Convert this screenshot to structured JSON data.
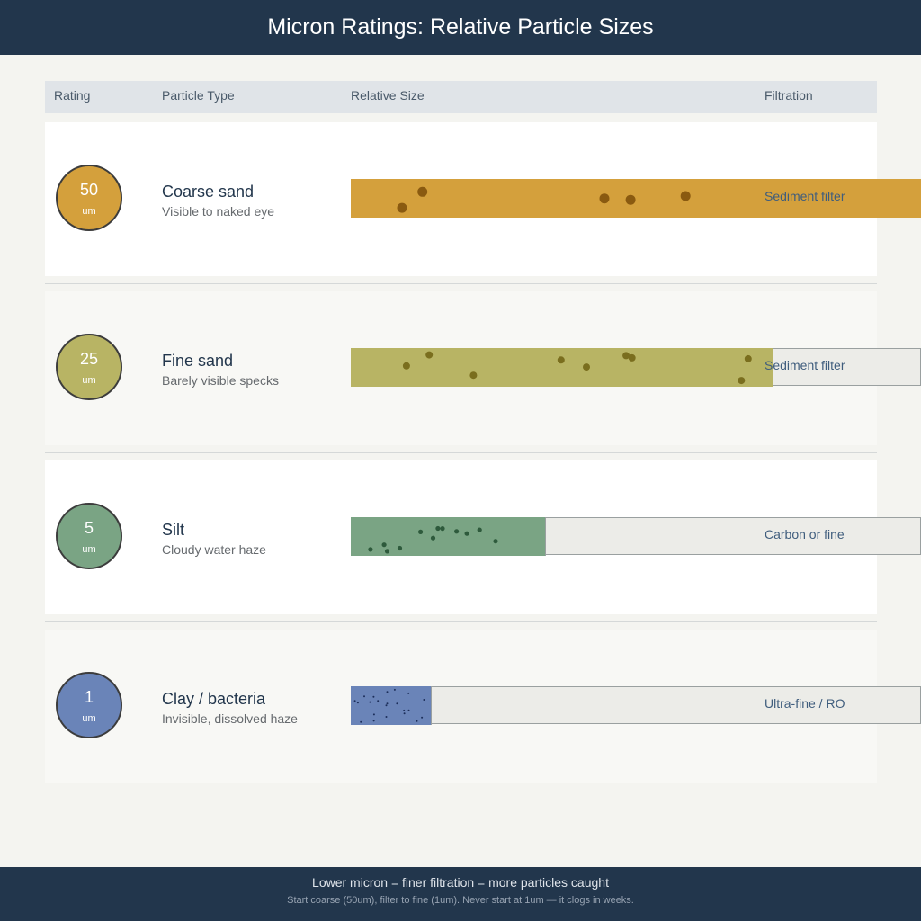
{
  "header": {
    "title": "Micron Ratings: Relative Particle Sizes"
  },
  "columns": {
    "rating": "Rating",
    "particle_type": "Particle Type",
    "relative_size": "Relative Size",
    "filtration": "Filtration"
  },
  "rows": [
    {
      "rating": "50",
      "unit": "um",
      "particle_type": "Coarse sand",
      "description": "Visible to naked eye",
      "filtration": "Sediment filter",
      "relative_size": 1.0,
      "color": "#d4a03c",
      "particle_color": "#8a5a10"
    },
    {
      "rating": "25",
      "unit": "um",
      "particle_type": "Fine sand",
      "description": "Barely visible specks",
      "filtration": "Sediment filter",
      "relative_size": 0.74,
      "color": "#b8b464",
      "particle_color": "#7a6e1e"
    },
    {
      "rating": "5",
      "unit": "um",
      "particle_type": "Silt",
      "description": "Cloudy water haze",
      "filtration": "Carbon or fine",
      "relative_size": 0.34,
      "color": "#7aa484",
      "particle_color": "#2e5a3c"
    },
    {
      "rating": "1",
      "unit": "um",
      "particle_type": "Clay / bacteria",
      "description": "Invisible, dissolved haze",
      "filtration": "Ultra-fine / RO",
      "relative_size": 0.14,
      "color": "#6a84b8",
      "particle_color": "#1c2e5a"
    }
  ],
  "footer": {
    "main": "Lower micron = finer filtration = more particles caught",
    "sub": "Start coarse (50um), filter to fine (1um). Never start at 1um — it clogs in weeks."
  }
}
